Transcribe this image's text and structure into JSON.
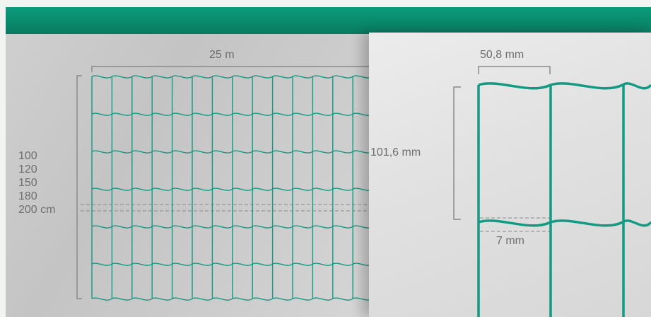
{
  "colors": {
    "header": "#0a8a6c",
    "mesh_wire": "#139a82",
    "dimension_line": "#8a8a8a",
    "text": "#6e6e6e"
  },
  "left_view": {
    "length_label": "25 m",
    "heights": [
      "100",
      "120",
      "150",
      "180",
      "200 cm"
    ]
  },
  "right_view": {
    "mesh_width_label": "50,8 mm",
    "mesh_height_label": "101,6 mm",
    "wave_depth_label": "7 mm"
  }
}
